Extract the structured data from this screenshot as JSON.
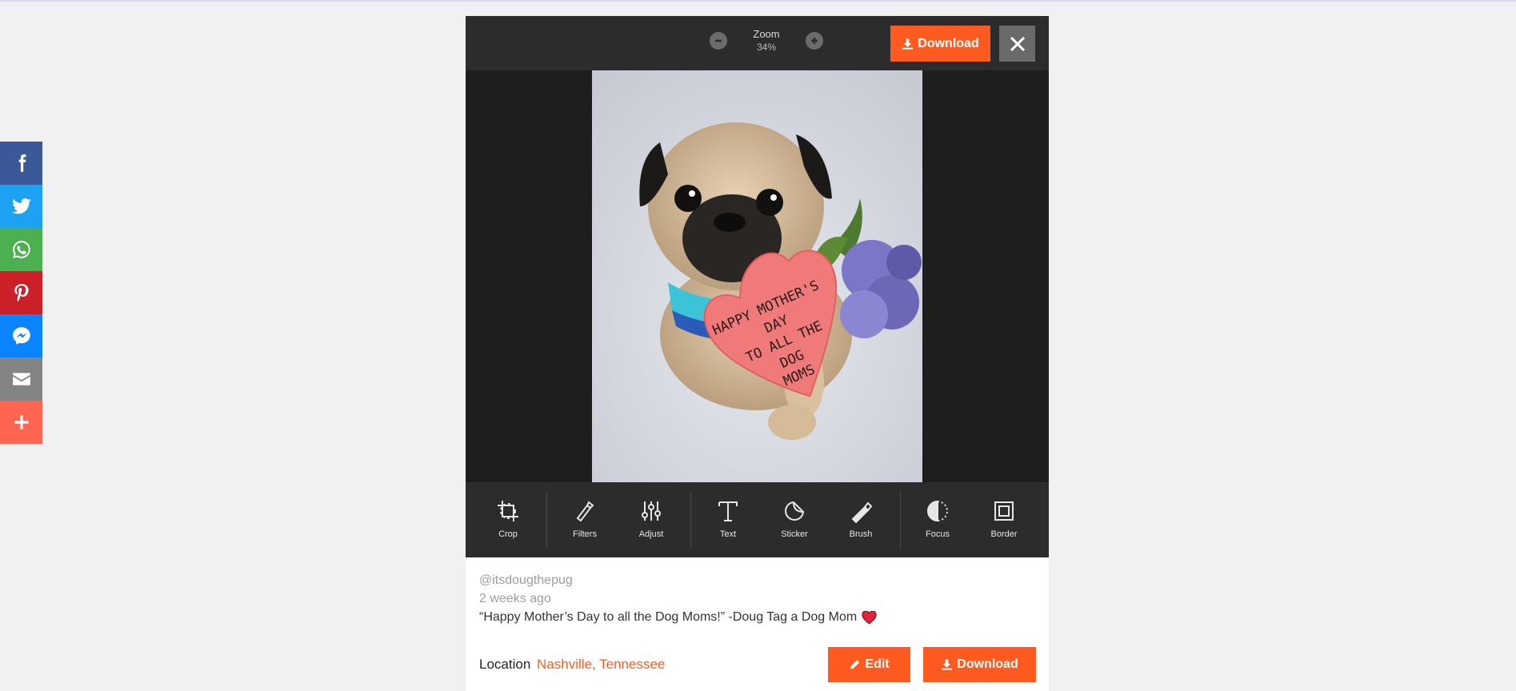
{
  "share": {
    "items": [
      {
        "name": "facebook",
        "color": "#3b5998"
      },
      {
        "name": "twitter",
        "color": "#1da1f2"
      },
      {
        "name": "whatsapp",
        "color": "#4caf50"
      },
      {
        "name": "pinterest",
        "color": "#cb2027"
      },
      {
        "name": "messenger",
        "color": "#0a84ff"
      },
      {
        "name": "email",
        "color": "#848484"
      },
      {
        "name": "more",
        "color": "#ff6550"
      }
    ]
  },
  "viewer": {
    "zoom_label": "Zoom",
    "zoom_value": "34%",
    "download_label": "Download",
    "tools": [
      {
        "label": "Crop",
        "icon": "crop-icon"
      },
      {
        "label": "Filters",
        "icon": "filters-icon"
      },
      {
        "label": "Adjust",
        "icon": "adjust-icon"
      },
      {
        "label": "Text",
        "icon": "text-icon"
      },
      {
        "label": "Sticker",
        "icon": "sticker-icon"
      },
      {
        "label": "Brush",
        "icon": "brush-icon"
      },
      {
        "label": "Focus",
        "icon": "focus-icon"
      },
      {
        "label": "Border",
        "icon": "border-icon"
      }
    ],
    "photo_heart_text": [
      "HAPPY MOTHER'S",
      "DAY",
      "TO ALL THE",
      "DOG",
      "MOMS"
    ]
  },
  "post": {
    "handle": "@itsdougthepug",
    "time_ago": "2 weeks ago",
    "caption": "“Happy Mother’s Day to all the Dog Moms!” -Doug Tag a Dog Mom",
    "location_label": "Location",
    "location_value": "Nashville, Tennessee",
    "edit_label": "Edit",
    "download_label": "Download"
  },
  "colors": {
    "accent": "#ff5a1f",
    "toolbar_bg": "#2c2c2c",
    "stage_bg": "#1e1e1e"
  }
}
